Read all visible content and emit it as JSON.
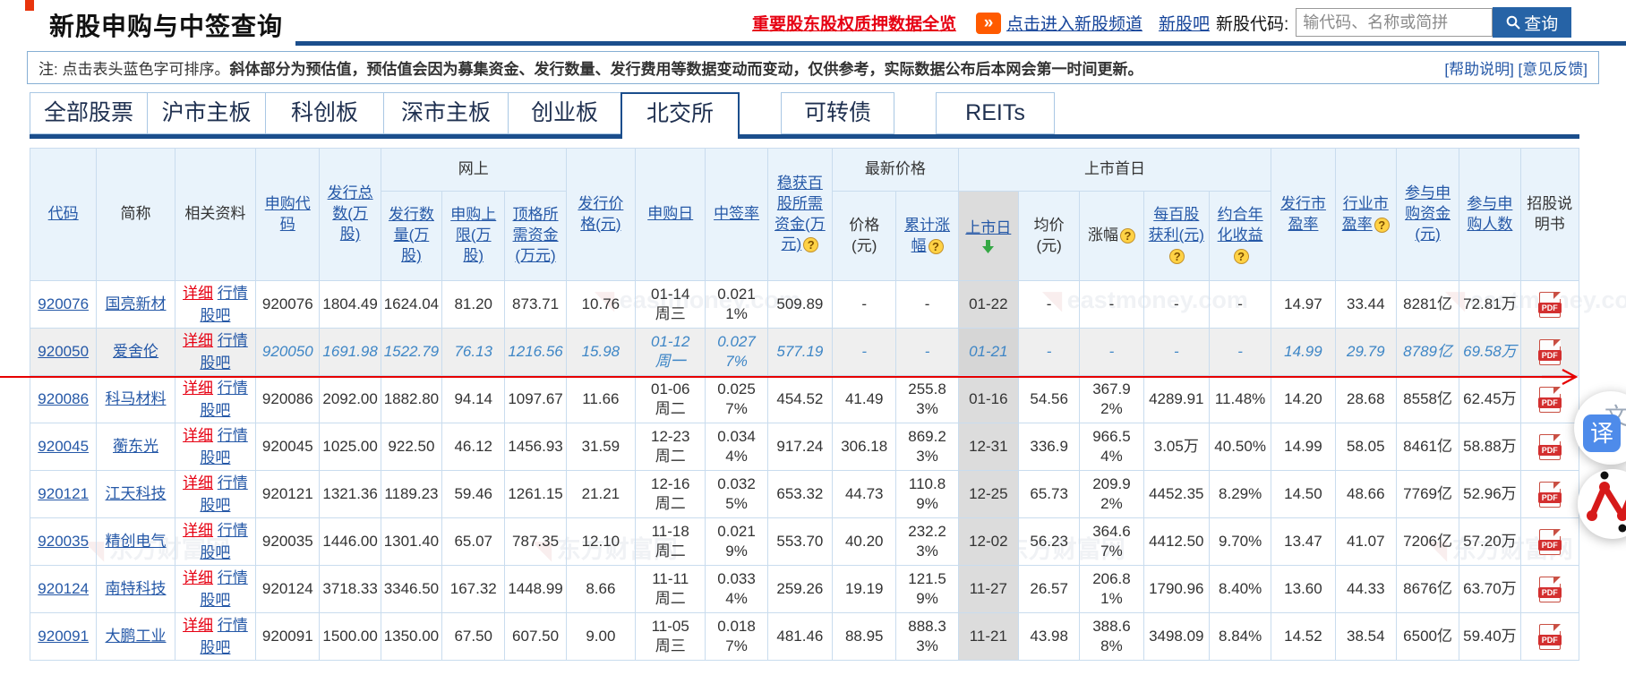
{
  "page": {
    "title": "新股申购与中签查询"
  },
  "links": {
    "pledge": "重要股东股权质押数据全览",
    "chevron": "»",
    "channel": "点击进入新股频道",
    "bar": "新股吧"
  },
  "search": {
    "label": "新股代码:",
    "placeholder": "输代码、名称或简拼",
    "button": "查询"
  },
  "note": {
    "prefix": "注: 点击表头蓝色字可排序。",
    "bold": "斜体部分为预估值，预估值会因为募集资金、发行数量、发行费用等数据变动而变动，仅供参考，实际数据公布后本网会第一时间更新。",
    "help": "[帮助说明]",
    "feedback": "[意见反馈]"
  },
  "tabs": {
    "items": [
      {
        "key": "all",
        "label": "全部股票",
        "active": false
      },
      {
        "key": "sh-main",
        "label": "沪市主板",
        "active": false
      },
      {
        "key": "star",
        "label": "科创板",
        "active": false
      },
      {
        "key": "sz-main",
        "label": "深市主板",
        "active": false
      },
      {
        "key": "chinext",
        "label": "创业板",
        "active": false
      },
      {
        "key": "bse",
        "label": "北交所",
        "active": true
      },
      {
        "key": "convertible",
        "label": "可转债",
        "active": false
      },
      {
        "key": "reits",
        "label": "REITs",
        "active": false
      }
    ]
  },
  "table": {
    "groups": {
      "online": "网上",
      "latest_price": "最新价格",
      "first_day": "上市首日"
    },
    "columns": {
      "code": "代码",
      "name": "简称",
      "related": "相关资料",
      "sub_code": "申购代码",
      "total_issue": "发行总数(万股)",
      "online_issue": "发行数量(万股)",
      "sub_limit": "申购上限(万股)",
      "max_fund": "顶格所需资金(万元)",
      "issue_price": "发行价格(元)",
      "sub_date": "申购日",
      "lottery_rate": "中签率",
      "fund_100": "稳获百股所需资金(万元)",
      "latest": "价格(元)",
      "cum_gain": "累计涨幅",
      "list_date": "上市日",
      "avg_price": "均价(元)",
      "day_gain": "涨幅",
      "profit_100": "每百股获利(元)",
      "annual": "约合年化收益",
      "issue_pe": "发行市盈率",
      "industry_pe": "行业市盈率",
      "sub_fund": "参与申购资金(元)",
      "sub_people": "参与申购人数",
      "prospectus": "招股说明书"
    },
    "related_links": {
      "detail": "详细",
      "quote": "行情",
      "guba": "股吧"
    },
    "pdf_label": "PDF",
    "rows": [
      {
        "code": "920076",
        "name": "国亮新材",
        "sub_code": "920076",
        "total_issue": "1804.49",
        "online_issue": "1624.04",
        "sub_limit": "81.20",
        "max_fund": "873.71",
        "issue_price": "10.76",
        "sub_date": "01-14|周三",
        "lottery_rate": "0.0211%",
        "fund_100": "509.89",
        "latest": "-",
        "cum_gain": "-",
        "list_date": "01-22",
        "avg_price": "-",
        "day_gain": "-",
        "profit_100": "-",
        "annual": "-",
        "issue_pe": "14.97",
        "industry_pe": "33.44",
        "sub_fund": "8281亿",
        "sub_people": "72.81万",
        "estimated": false,
        "highlight": false
      },
      {
        "code": "920050",
        "name": "爱舍伦",
        "sub_code": "920050",
        "total_issue": "1691.98",
        "online_issue": "1522.79",
        "sub_limit": "76.13",
        "max_fund": "1216.56",
        "issue_price": "15.98",
        "sub_date": "01-12|周一",
        "lottery_rate": "0.0277%",
        "fund_100": "577.19",
        "latest": "-",
        "cum_gain": "-",
        "list_date": "01-21",
        "avg_price": "-",
        "day_gain": "-",
        "profit_100": "-",
        "annual": "-",
        "issue_pe": "14.99",
        "industry_pe": "29.79",
        "sub_fund": "8789亿",
        "sub_people": "69.58万",
        "estimated": true,
        "highlight": true
      },
      {
        "code": "920086",
        "name": "科马材料",
        "sub_code": "920086",
        "total_issue": "2092.00",
        "online_issue": "1882.80",
        "sub_limit": "94.14",
        "max_fund": "1097.67",
        "issue_price": "11.66",
        "sub_date": "01-06|周二",
        "lottery_rate": "0.0257%",
        "fund_100": "454.52",
        "latest": "41.49",
        "cum_gain": "255.83%",
        "list_date": "01-16",
        "avg_price": "54.56",
        "day_gain": "367.92%",
        "profit_100": "4289.91",
        "annual": "11.48%",
        "issue_pe": "14.20",
        "industry_pe": "28.68",
        "sub_fund": "8558亿",
        "sub_people": "62.45万",
        "estimated": false,
        "highlight": false
      },
      {
        "code": "920045",
        "name": "蘅东光",
        "sub_code": "920045",
        "total_issue": "1025.00",
        "online_issue": "922.50",
        "sub_limit": "46.12",
        "max_fund": "1456.93",
        "issue_price": "31.59",
        "sub_date": "12-23|周二",
        "lottery_rate": "0.0344%",
        "fund_100": "917.24",
        "latest": "306.18",
        "cum_gain": "869.23%",
        "list_date": "12-31",
        "avg_price": "336.9",
        "day_gain": "966.54%",
        "profit_100": "3.05万",
        "annual": "40.50%",
        "issue_pe": "14.99",
        "industry_pe": "58.05",
        "sub_fund": "8461亿",
        "sub_people": "58.88万",
        "estimated": false,
        "highlight": false
      },
      {
        "code": "920121",
        "name": "江天科技",
        "sub_code": "920121",
        "total_issue": "1321.36",
        "online_issue": "1189.23",
        "sub_limit": "59.46",
        "max_fund": "1261.15",
        "issue_price": "21.21",
        "sub_date": "12-16|周二",
        "lottery_rate": "0.0325%",
        "fund_100": "653.32",
        "latest": "44.73",
        "cum_gain": "110.89%",
        "list_date": "12-25",
        "avg_price": "65.73",
        "day_gain": "209.92%",
        "profit_100": "4452.35",
        "annual": "8.29%",
        "issue_pe": "14.50",
        "industry_pe": "48.66",
        "sub_fund": "7769亿",
        "sub_people": "52.96万",
        "estimated": false,
        "highlight": false
      },
      {
        "code": "920035",
        "name": "精创电气",
        "sub_code": "920035",
        "total_issue": "1446.00",
        "online_issue": "1301.40",
        "sub_limit": "65.07",
        "max_fund": "787.35",
        "issue_price": "12.10",
        "sub_date": "11-18|周二",
        "lottery_rate": "0.0219%",
        "fund_100": "553.70",
        "latest": "40.20",
        "cum_gain": "232.23%",
        "list_date": "12-02",
        "avg_price": "56.23",
        "day_gain": "364.67%",
        "profit_100": "4412.50",
        "annual": "9.70%",
        "issue_pe": "13.47",
        "industry_pe": "41.07",
        "sub_fund": "7206亿",
        "sub_people": "57.20万",
        "estimated": false,
        "highlight": false
      },
      {
        "code": "920124",
        "name": "南特科技",
        "sub_code": "920124",
        "total_issue": "3718.33",
        "online_issue": "3346.50",
        "sub_limit": "167.32",
        "max_fund": "1448.99",
        "issue_price": "8.66",
        "sub_date": "11-11|周二",
        "lottery_rate": "0.0334%",
        "fund_100": "259.26",
        "latest": "19.19",
        "cum_gain": "121.59%",
        "list_date": "11-27",
        "avg_price": "26.57",
        "day_gain": "206.81%",
        "profit_100": "1790.96",
        "annual": "8.40%",
        "issue_pe": "13.60",
        "industry_pe": "44.33",
        "sub_fund": "8676亿",
        "sub_people": "63.70万",
        "estimated": false,
        "highlight": false
      },
      {
        "code": "920091",
        "name": "大鹏工业",
        "sub_code": "920091",
        "total_issue": "1500.00",
        "online_issue": "1350.00",
        "sub_limit": "67.50",
        "max_fund": "607.50",
        "issue_price": "9.00",
        "sub_date": "11-05|周三",
        "lottery_rate": "0.0187%",
        "fund_100": "481.46",
        "latest": "88.95",
        "cum_gain": "888.33%",
        "list_date": "11-21",
        "avg_price": "43.98",
        "day_gain": "388.68%",
        "profit_100": "3498.09",
        "annual": "8.84%",
        "issue_pe": "14.52",
        "industry_pe": "38.54",
        "sub_fund": "6500亿",
        "sub_people": "59.40万",
        "estimated": false,
        "highlight": false
      }
    ]
  },
  "watermark": {
    "en": "eastmoney.com",
    "cn": "东方财富网"
  },
  "floating": {
    "translate_main": "译",
    "translate_alt": "文"
  }
}
